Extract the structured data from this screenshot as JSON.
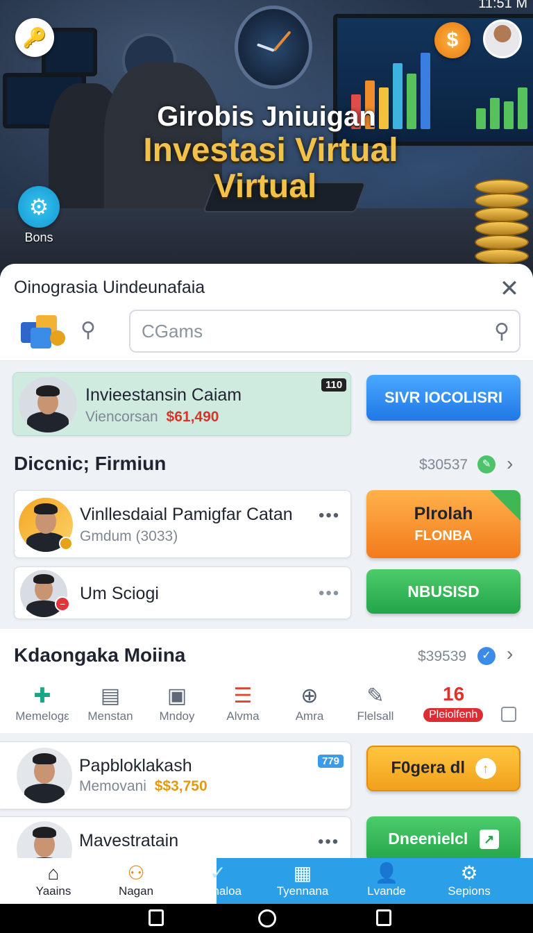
{
  "status_bar": {
    "time": "11:51 M"
  },
  "hero": {
    "title_line1": "Girobis Jniuigan",
    "title_line2": "Investasi Virtual",
    "title_line3": "Virtual",
    "bonus_label": "Bons",
    "dollar_glyph": "$"
  },
  "sheet": {
    "title": "Oinograsia Uindeunafaia",
    "close_glyph": "✕",
    "search_placeholder": "CGams"
  },
  "featured": {
    "title": "Invieestansin Caiam",
    "sub_label": "Viencorsan",
    "amount": "$61,490",
    "badge": "110",
    "button": "SIVR IOCOLISRI"
  },
  "section1": {
    "title": "Diccnic; Firmiun",
    "amount": "$30537"
  },
  "row1": {
    "title": "Vinllesdaial Pamigfar Catan",
    "sub": "Gmdum (3033)",
    "dots": "•••",
    "button_line1": "Plrolah",
    "button_line2": "FLONBA"
  },
  "row2": {
    "title": "Um Sciogi",
    "dots": "•••",
    "button": "NBUSISD"
  },
  "section2": {
    "title": "Kdaongaka Moiina",
    "amount": "$39539"
  },
  "icons": [
    {
      "label": "Memelogε",
      "glyph": "✚",
      "color": "#17a689"
    },
    {
      "label": "Menstan",
      "glyph": "▤",
      "color": "#5e6878"
    },
    {
      "label": "Mndoy",
      "glyph": "▣",
      "color": "#5e6878"
    },
    {
      "label": "Alvma",
      "glyph": "☰",
      "color": "#e0452f"
    },
    {
      "label": "Amra",
      "glyph": "⊕",
      "color": "#4e5a6d"
    },
    {
      "label": "Flelsall",
      "glyph": "✎",
      "color": "#5e6878"
    }
  ],
  "icon_extra": {
    "number": "16",
    "pill": "Pleiolfenh"
  },
  "row3": {
    "title": "Papbloklakash",
    "sub_label": "Memovani",
    "amount": "$$3,750",
    "badge": "779",
    "button": "F0gera dl"
  },
  "row4": {
    "title": "Mavestratain",
    "dots": "•••",
    "button": "Dneenielcl"
  },
  "nav": [
    {
      "label": "Yaains",
      "glyph": "⌂"
    },
    {
      "label": "Nagan",
      "glyph": "⚇"
    },
    {
      "label": "Comaloa",
      "glyph": "✓"
    },
    {
      "label": "Tyennana",
      "glyph": "▦"
    },
    {
      "label": "Lvande",
      "glyph": "👤"
    },
    {
      "label": "Sepions",
      "glyph": "⚙"
    }
  ]
}
